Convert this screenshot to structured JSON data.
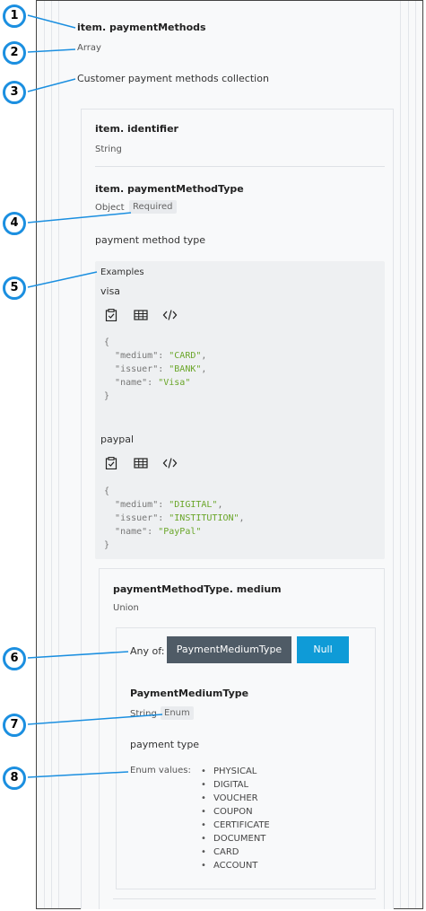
{
  "payment_methods": {
    "title": "item. paymentMethods",
    "type": "Array",
    "description": "Customer payment methods collection"
  },
  "identifier": {
    "title": "item. identifier",
    "type": "String"
  },
  "payment_method_type": {
    "title": "item. paymentMethodType",
    "type": "Object",
    "required_badge": "Required",
    "description": "payment method type"
  },
  "examples": {
    "label": "Examples",
    "items": [
      {
        "name": "visa",
        "code_open": "{",
        "lines": [
          {
            "key": "\"medium\"",
            "value": "\"CARD\"",
            "comma": ","
          },
          {
            "key": "\"issuer\"",
            "value": "\"BANK\"",
            "comma": ","
          },
          {
            "key": "\"name\"",
            "value": "\"Visa\"",
            "comma": ""
          }
        ],
        "code_close": "}"
      },
      {
        "name": "paypal",
        "code_open": "{",
        "lines": [
          {
            "key": "\"medium\"",
            "value": "\"DIGITAL\"",
            "comma": ","
          },
          {
            "key": "\"issuer\"",
            "value": "\"INSTITUTION\"",
            "comma": ","
          },
          {
            "key": "\"name\"",
            "value": "\"PayPal\"",
            "comma": ""
          }
        ],
        "code_close": "}"
      }
    ],
    "icons": [
      "clipboard-icon",
      "table-icon",
      "code-icon"
    ]
  },
  "medium": {
    "title": "paymentMethodType. medium",
    "type": "Union",
    "any_of_label": "Any of:",
    "options": [
      "PaymentMediumType",
      "Null"
    ],
    "option_colors": [
      "#4f5b66",
      "#0f9bd7"
    ]
  },
  "payment_medium_type": {
    "title": "PaymentMediumType",
    "type": "String",
    "enum_badge": "Enum",
    "description": "payment type",
    "enum_label": "Enum values:",
    "enum_values": [
      "PHYSICAL",
      "DIGITAL",
      "VOUCHER",
      "COUPON",
      "CERTIFICATE",
      "DOCUMENT",
      "CARD",
      "ACCOUNT"
    ]
  },
  "callouts": [
    "1",
    "2",
    "3",
    "4",
    "5",
    "6",
    "7",
    "8"
  ],
  "colors": {
    "callout_ring": "#1b8fe0",
    "code_string": "#6aa629"
  }
}
